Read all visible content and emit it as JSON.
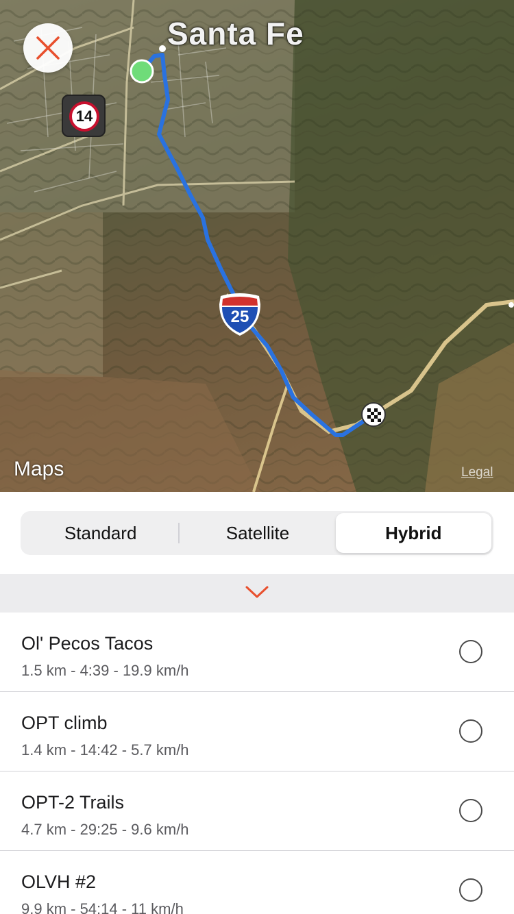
{
  "map": {
    "city_label": "Santa Fe",
    "route_number": "14",
    "interstate_number": "25",
    "attribution": "Maps",
    "legal_label": "Legal",
    "start_marker": "green-dot",
    "finish_marker": "checkered-flag",
    "route_color": "#2a72e0"
  },
  "map_types": {
    "options": [
      "Standard",
      "Satellite",
      "Hybrid"
    ],
    "selected": "Hybrid"
  },
  "accent_color": "#e8502e",
  "routes": [
    {
      "name": "Ol' Pecos Tacos",
      "stats": "1.5 km - 4:39 - 19.9 km/h"
    },
    {
      "name": "OPT climb",
      "stats": "1.4 km - 14:42 - 5.7 km/h"
    },
    {
      "name": "OPT-2 Trails",
      "stats": "4.7 km - 29:25 - 9.6 km/h"
    },
    {
      "name": "OLVH #2",
      "stats": "9.9 km - 54:14 - 11 km/h"
    }
  ]
}
